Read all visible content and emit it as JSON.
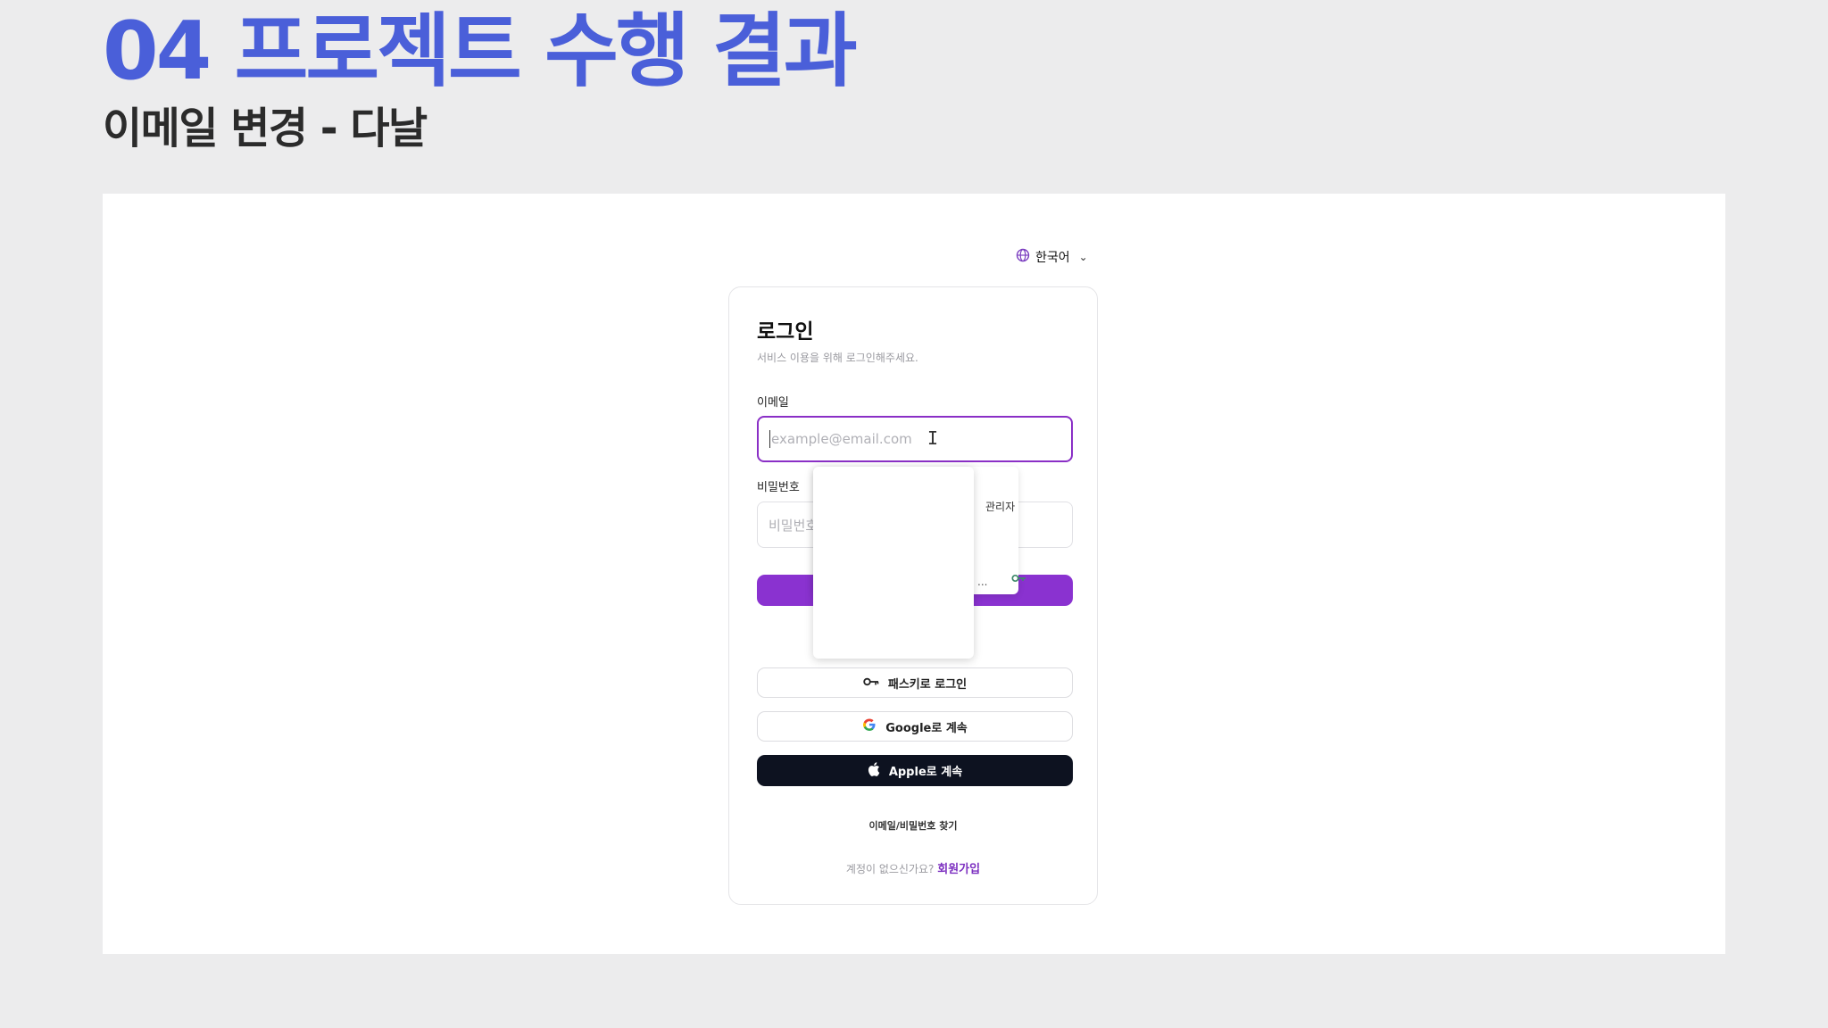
{
  "slide": {
    "title": "04 프로젝트 수행 결과",
    "subtitle": "이메일 변경 - 다날"
  },
  "language": {
    "label": "한국어",
    "icon": "globe-icon"
  },
  "login": {
    "title": "로그인",
    "subtitle": "서비스 이용을 위해 로그인해주세요.",
    "email_label": "이메일",
    "email_placeholder": "example@email.com",
    "password_label": "비밀번호",
    "password_placeholder": "비밀번호",
    "passkey_label": "패스키로 로그인",
    "google_label": "Google로 계속",
    "apple_label": "Apple로 계속",
    "find_label": "이메일/비밀번호 찾기",
    "no_account_text": "계정이 없으신가요?",
    "signup_label": "회원가입"
  },
  "autofill_popup": {
    "partial_text": "관리자",
    "ellipsis": "..."
  },
  "colors": {
    "title": "#4a5fd9",
    "accent": "#8a32d0",
    "apple_button": "#0d1220"
  }
}
